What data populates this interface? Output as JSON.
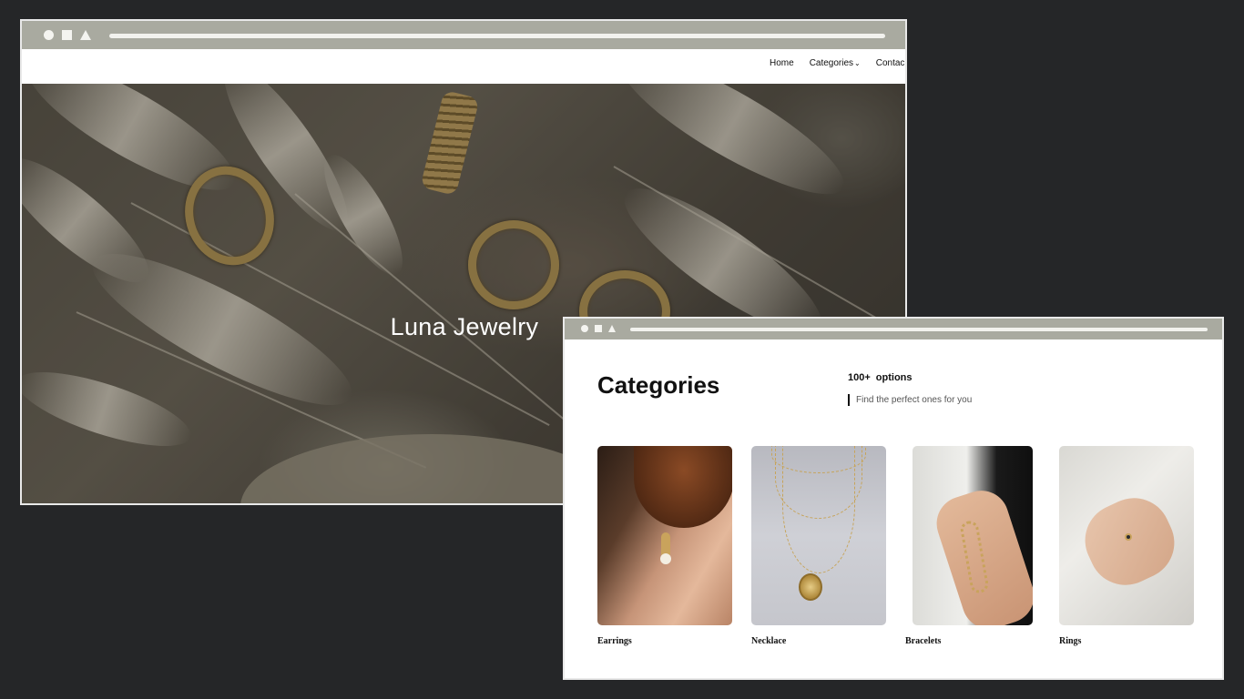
{
  "window_home": {
    "nav": {
      "home": "Home",
      "categories": "Categories",
      "contact": "Contac"
    },
    "hero_title": "Luna Jewelry"
  },
  "window_categories": {
    "title": "Categories",
    "options_count": "100+",
    "options_word": "options",
    "subtitle": "Find the perfect ones for you",
    "cards": [
      {
        "label": "Earrings"
      },
      {
        "label": "Necklace"
      },
      {
        "label": "Bracelets"
      },
      {
        "label": "Rings"
      }
    ]
  },
  "colors": {
    "background": "#252628",
    "titlebar": "#a9aaa0",
    "gold": "#c9a35c"
  },
  "icons": [
    "circle-icon",
    "square-icon",
    "triangle-icon",
    "chevron-down-icon"
  ]
}
